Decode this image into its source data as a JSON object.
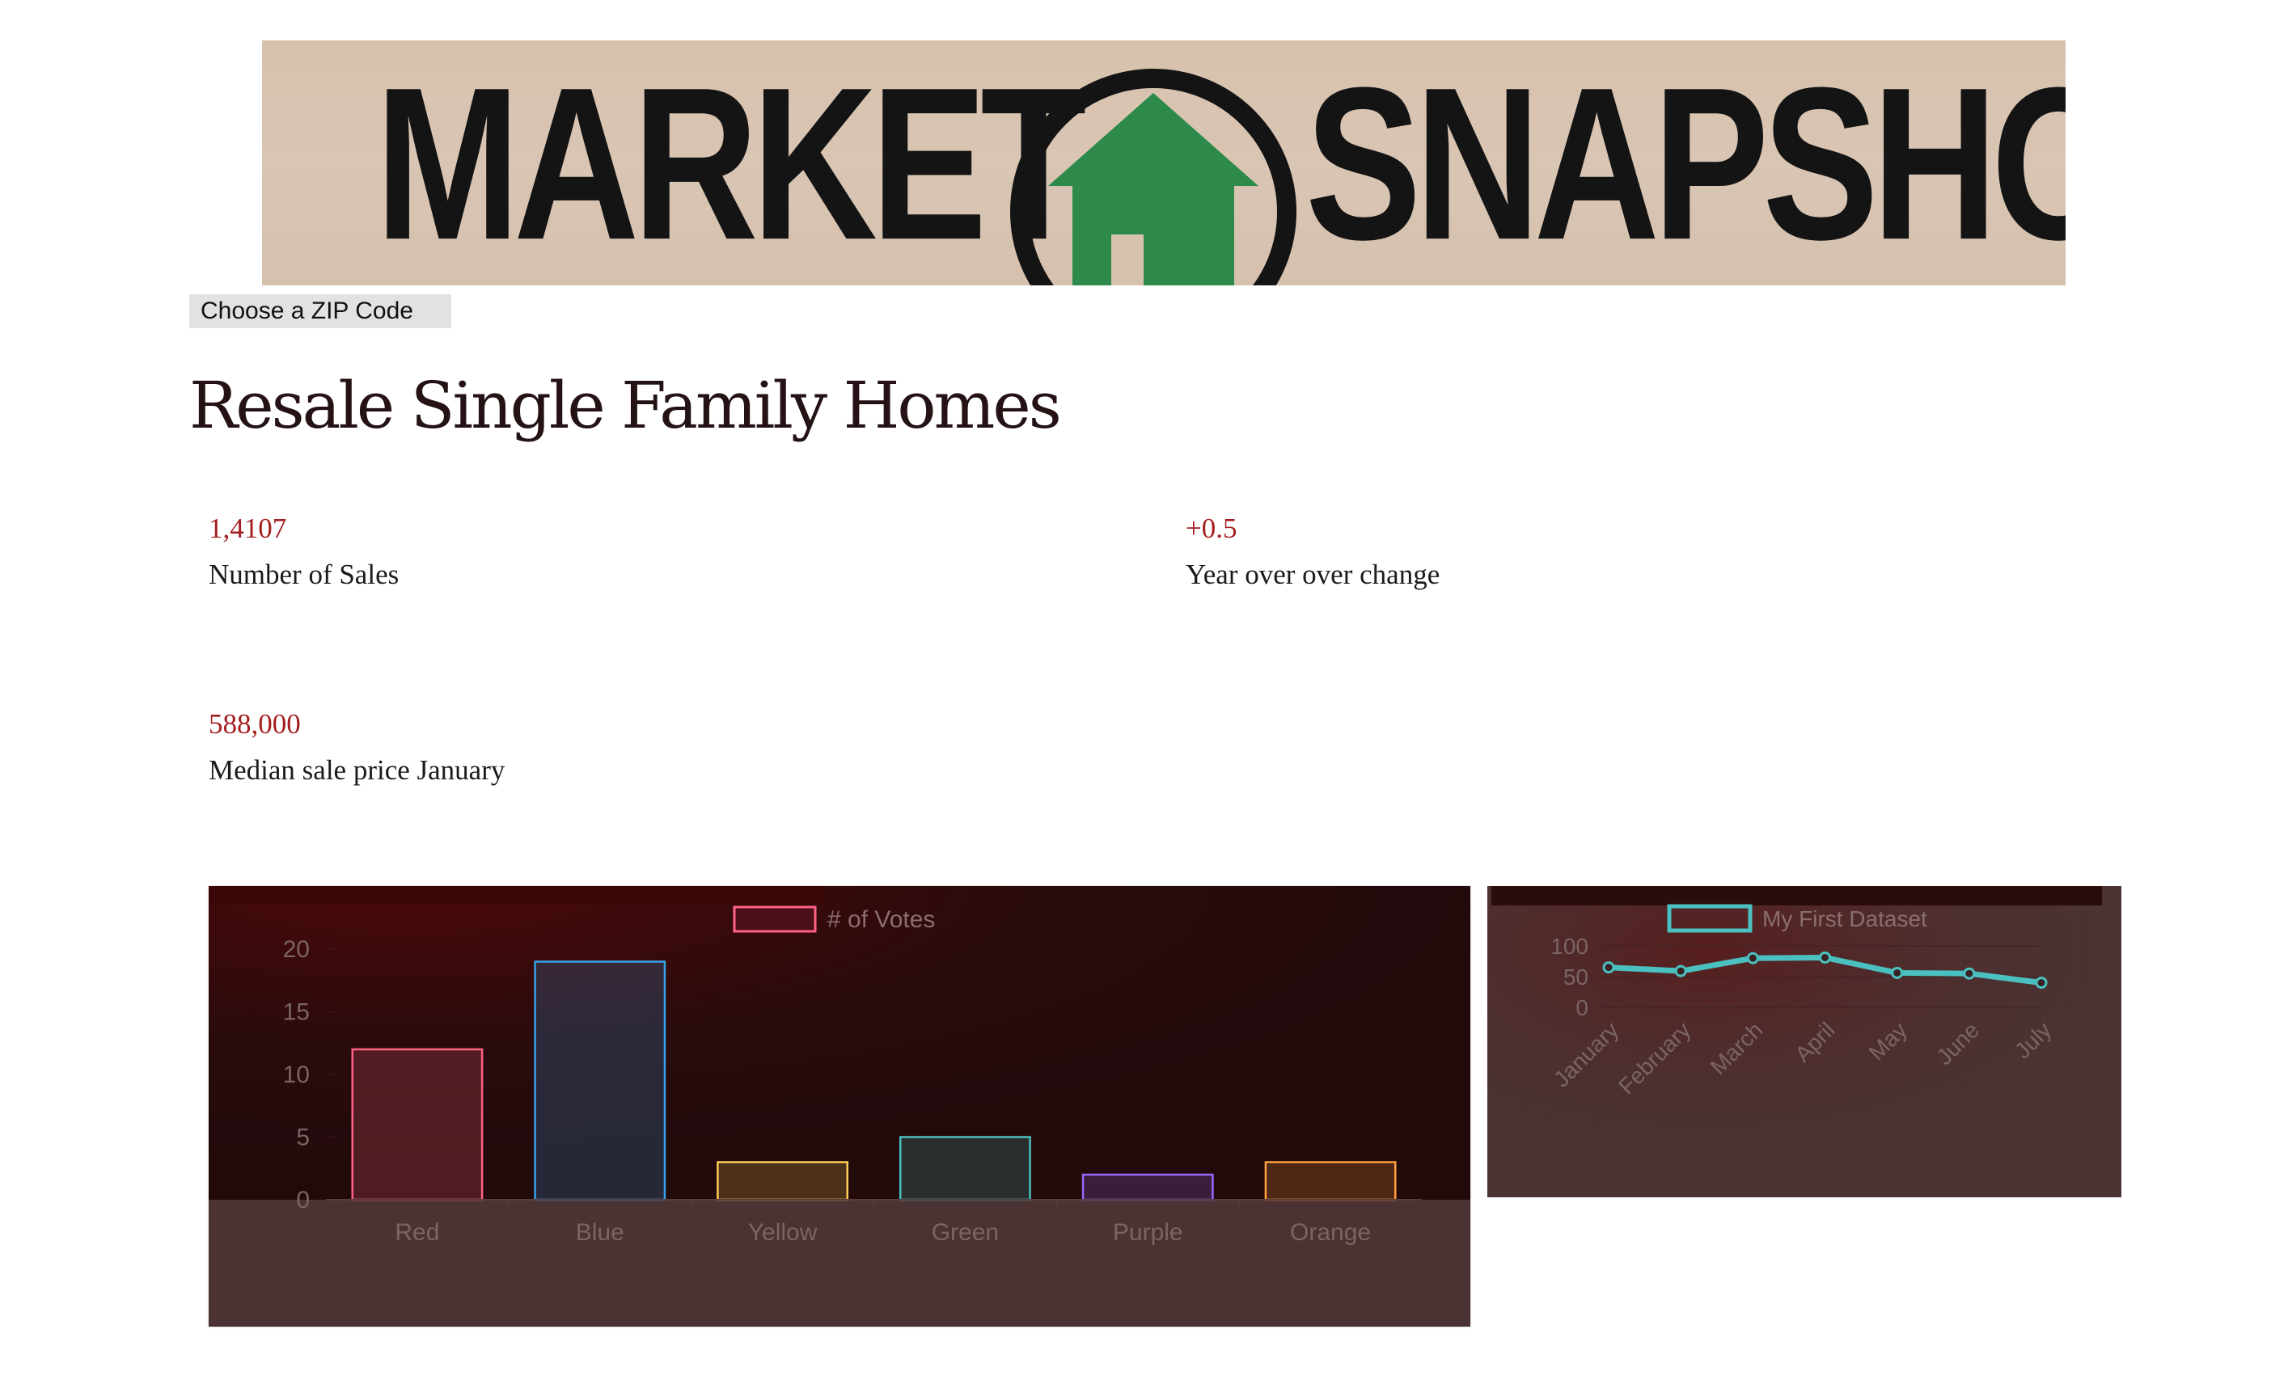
{
  "banner": {
    "word_left": "MARKET",
    "word_right": "SNAPSHOT",
    "logo_icon": "house-icon",
    "house_color": "#2e8a4a"
  },
  "zip_button": {
    "label": "Choose a ZIP Code"
  },
  "section": {
    "title": "Resale Single Family Homes"
  },
  "stats": [
    {
      "value": "1,4107",
      "label": "Number of Sales"
    },
    {
      "value": "+0.5",
      "label": "Year over over change"
    },
    {
      "value": "588,000",
      "label": "Median sale price January"
    }
  ],
  "colors": {
    "accent_value": "#a41e20",
    "chart_background": "#4b3233"
  },
  "chart_data": [
    {
      "type": "bar",
      "categories": [
        "Red",
        "Blue",
        "Yellow",
        "Green",
        "Purple",
        "Orange"
      ],
      "series": [
        {
          "name": "# of Votes",
          "values": [
            12,
            19,
            3,
            5,
            2,
            3
          ],
          "border_colors": [
            "#ff6384",
            "#36a2eb",
            "#ffce56",
            "#4bc0c0",
            "#9966ff",
            "#ff9f40"
          ]
        }
      ],
      "yticks": [
        "0",
        "5",
        "10",
        "15",
        "20"
      ],
      "ylim": [
        0,
        20
      ],
      "legend": "top-center"
    },
    {
      "type": "line",
      "categories": [
        "January",
        "February",
        "March",
        "April",
        "May",
        "June",
        "July"
      ],
      "series": [
        {
          "name": "My First Dataset",
          "values": [
            65,
            59,
            80,
            81,
            56,
            55,
            40
          ],
          "color": "#4bc0c0"
        }
      ],
      "yticks": [
        "0",
        "50",
        "100"
      ],
      "ylim": [
        0,
        100
      ],
      "legend": "top-center"
    }
  ]
}
